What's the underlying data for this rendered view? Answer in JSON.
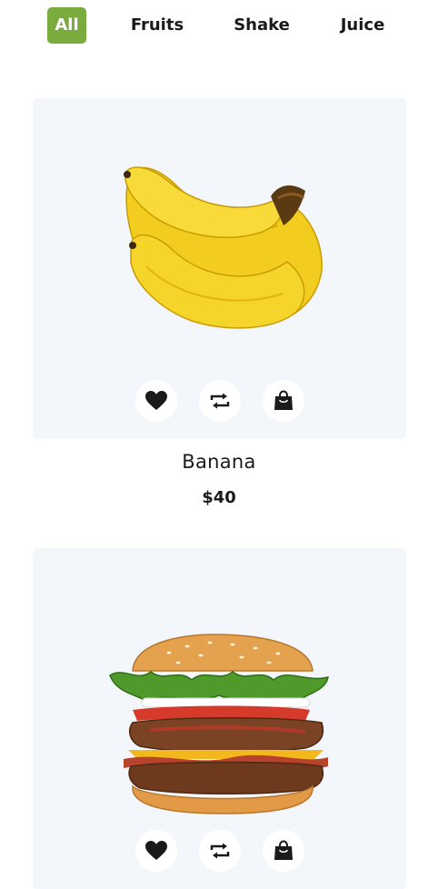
{
  "tabs": [
    {
      "label": "All",
      "active": true
    },
    {
      "label": "Fruits",
      "active": false
    },
    {
      "label": "Shake",
      "active": false
    },
    {
      "label": "Juice",
      "active": false
    }
  ],
  "products": [
    {
      "name": "Banana",
      "price": "$40",
      "image": "banana"
    },
    {
      "name": "",
      "price": "",
      "image": "burger"
    }
  ],
  "icons": {
    "wishlist": "heart-icon",
    "compare": "repeat-icon",
    "cart": "shopping-bag-icon"
  },
  "colors": {
    "accent": "#7aab3d",
    "card_bg": "#f3f6fb",
    "text": "#1a1a1a"
  }
}
